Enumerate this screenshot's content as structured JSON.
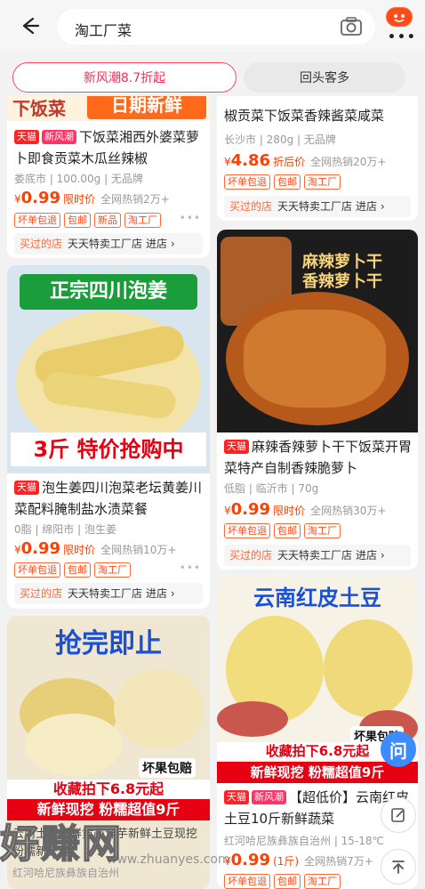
{
  "search": {
    "query": "淘工厂菜"
  },
  "header": {
    "badge_icon": "emoji-face-icon"
  },
  "tabs": [
    {
      "label": "新风潮8.7折起"
    },
    {
      "label": "回头客多"
    }
  ],
  "top_banner": {
    "left_text": "下饭菜",
    "right_text": "日期新鲜"
  },
  "products": [
    {
      "tags": [
        "天猫",
        "新风潮"
      ],
      "title": "下饭菜湘西外婆菜萝卜即食贡菜木瓜丝辣椒",
      "meta": "娄底市 | 100.00g | 无品牌",
      "price": "0.99",
      "price_label": "限时价",
      "sold": "全网热销2万+",
      "badges": [
        "坏单包退",
        "包邮",
        "新品",
        "淘工厂"
      ],
      "shop_label": "买过的店",
      "shop_name": "天天特卖工厂店",
      "shop_go": "进店 ›"
    },
    {
      "title_top": "椒贡菜下饭菜香辣酱菜咸菜",
      "meta": "长沙市 | 280g | 无品牌",
      "price": "4.86",
      "price_label": "折后价",
      "sold": "全网热销20万+",
      "badges": [
        "坏单包退",
        "包邮",
        "淘工厂"
      ],
      "shop_label": "买过的店",
      "shop_name": "天天特卖工厂店",
      "shop_go": "进店 ›"
    },
    {
      "img_title": "正宗四川泡姜",
      "img_promo": "3斤 特价抢购中",
      "tags": [
        "天猫"
      ],
      "title": "泡生姜四川泡菜老坛黄姜川菜配料腌制盐水渍菜餐",
      "meta": "0脂 | 绵阳市 | 泡生姜",
      "price": "0.99",
      "price_label": "限时价",
      "sold": "全网热销10万+",
      "badges": [
        "坏单包退",
        "包邮",
        "淘工厂"
      ],
      "shop_label": "买过的店",
      "shop_name": "天天特卖工厂店",
      "shop_go": "进店 ›"
    },
    {
      "img_title_1": "麻辣萝卜干",
      "img_title_2": "香辣萝卜干",
      "tags": [
        "天猫"
      ],
      "title": "麻辣香辣萝卜干下饭菜开胃菜特产自制香辣脆萝卜",
      "meta": "低脂 | 临沂市 | 70g",
      "price": "0.99",
      "price_label": "限时价",
      "sold": "全网热销30万+",
      "badges": [
        "坏单包退",
        "包邮",
        "淘工厂"
      ],
      "shop_label": "买过的店",
      "shop_name": "天天特卖工厂店",
      "shop_go": "进店 ›"
    },
    {
      "img_title": "抢完即止",
      "img_tag": "坏果包赔",
      "img_promo_1": "收藏拍下6.8元起",
      "img_promo_2": "新鲜现挖 粉糯超值9斤",
      "title": "云南土豆新鲜黄心洋芋新鲜土豆现挖粉糯新土豆",
      "meta": "红河哈尼族彝族自治州"
    },
    {
      "img_title": "云南红皮土豆",
      "img_tag": "坏果包赔",
      "img_promo_1": "收藏拍下6.8元起",
      "img_promo_2": "新鲜现挖 粉糯超值9斤",
      "tags": [
        "天猫",
        "新风潮"
      ],
      "title": "【超低价】云南红皮土豆10斤新鲜蔬菜",
      "meta": "红河哈尼族彝族自治州 | 15-18℃",
      "price": "0.99",
      "price_label": "(1斤)",
      "sold": "全网热销7万+",
      "badges": [
        "坏单包退",
        "包邮",
        "淘工厂"
      ]
    }
  ],
  "watermark": "好赚网",
  "watermark_url": "www.zhuanyes.com",
  "colors": {
    "accent": "#ff4000",
    "tmall": "#ff2222",
    "tab_border": "#ff4466"
  }
}
